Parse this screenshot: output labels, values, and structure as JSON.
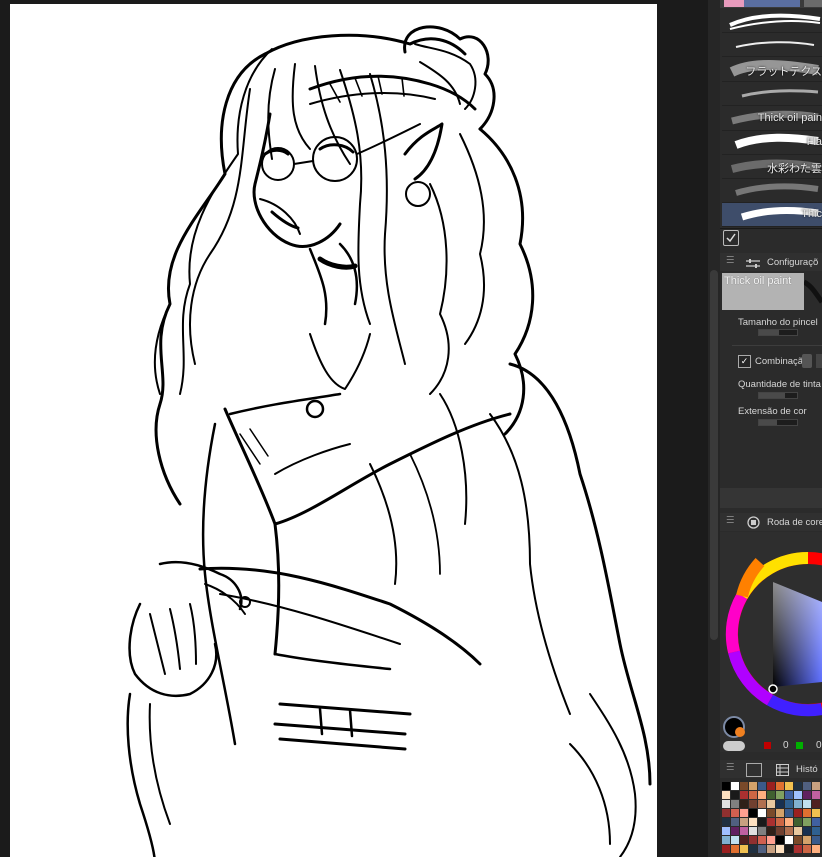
{
  "brush_panel": {
    "brushes": [
      {
        "name": "",
        "selected": false
      },
      {
        "name": "",
        "selected": false
      },
      {
        "name": "フラットテクス",
        "selected": false
      },
      {
        "name": "",
        "selected": false
      },
      {
        "name": "Thick oil pain",
        "selected": false
      },
      {
        "name": "Fla",
        "selected": false
      },
      {
        "name": "水彩わた雲",
        "selected": false
      },
      {
        "name": "",
        "selected": false
      },
      {
        "name": "Thic",
        "selected": true
      }
    ]
  },
  "tool_property": {
    "title": "Configuraçõ",
    "preview_label": "Thick oil paint",
    "brush_size_label": "Tamanho do pincel",
    "blend_label": "Combinaçã",
    "blend_checked": true,
    "paint_amount_label": "Quantidade de tinta",
    "color_stretch_label": "Extensão de cor"
  },
  "color_wheel": {
    "title": "Roda de core",
    "r_value": "0",
    "g_value": "0",
    "current_color": "#000000"
  },
  "bottom_tabs": {
    "history_label": "Histó"
  },
  "colors": {
    "selected_brush_bg": "#3e4d6a",
    "panel_bg": "#2b2b2b",
    "canvas_bg": "#ffffff"
  }
}
